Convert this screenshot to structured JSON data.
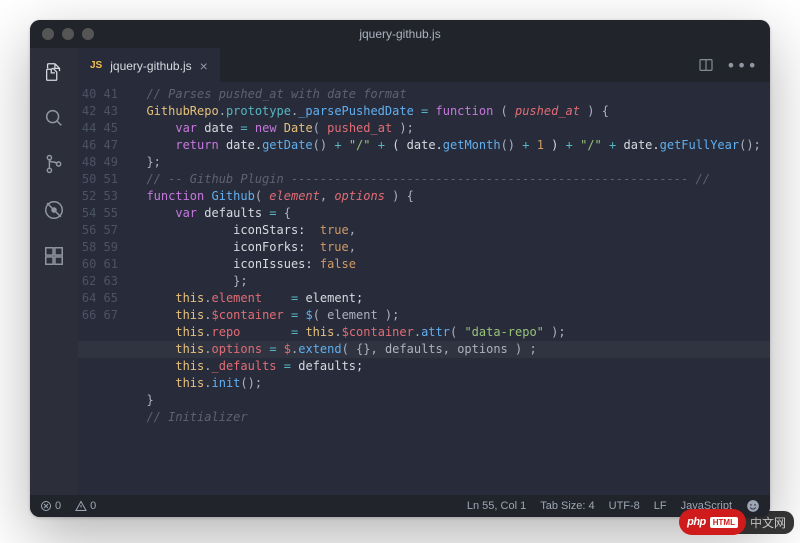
{
  "window": {
    "title": "jquery-github.js"
  },
  "activity": {
    "items": [
      "explorer",
      "search",
      "source-control",
      "debug",
      "extensions"
    ]
  },
  "tab": {
    "lang": "JS",
    "name": "jquery-github.js"
  },
  "editor": {
    "first_line": 40,
    "highlighted_line": 55,
    "lines": [
      [
        [
          "  ",
          ""
        ],
        [
          "// Parses pushed_at with date format",
          "c-comment"
        ]
      ],
      [
        [
          "  ",
          ""
        ],
        [
          "GithubRepo",
          "c-class"
        ],
        [
          ".",
          "c-punc"
        ],
        [
          "prototype",
          "c-prop"
        ],
        [
          ".",
          "c-punc"
        ],
        [
          "_parsePushedDate",
          "c-func"
        ],
        [
          " ",
          ""
        ],
        [
          "=",
          "c-op"
        ],
        [
          " ",
          ""
        ],
        [
          "function",
          "c-key"
        ],
        [
          " ( ",
          "c-punc"
        ],
        [
          "pushed_at",
          "c-param"
        ],
        [
          " ) {",
          "c-punc"
        ]
      ],
      [
        [
          "      ",
          ""
        ],
        [
          "var",
          "c-key"
        ],
        [
          " date ",
          ""
        ],
        [
          "=",
          "c-op"
        ],
        [
          " ",
          ""
        ],
        [
          "new",
          "c-key"
        ],
        [
          " ",
          ""
        ],
        [
          "Date",
          "c-class"
        ],
        [
          "( ",
          "c-punc"
        ],
        [
          "pushed_at",
          "c-var"
        ],
        [
          " );",
          "c-punc"
        ]
      ],
      [
        [
          "",
          ""
        ]
      ],
      [
        [
          "      ",
          ""
        ],
        [
          "return",
          "c-key"
        ],
        [
          " date.",
          ""
        ],
        [
          "getDate",
          "c-func"
        ],
        [
          "() ",
          "c-punc"
        ],
        [
          "+",
          "c-op"
        ],
        [
          " ",
          ""
        ],
        [
          "\"/\"",
          "c-str"
        ],
        [
          " ",
          ""
        ],
        [
          "+",
          "c-op"
        ],
        [
          " ( date.",
          ""
        ],
        [
          "getMonth",
          "c-func"
        ],
        [
          "() ",
          "c-punc"
        ],
        [
          "+",
          "c-op"
        ],
        [
          " ",
          ""
        ],
        [
          "1",
          "c-num"
        ],
        [
          " ) ",
          ""
        ],
        [
          "+",
          "c-op"
        ],
        [
          " ",
          ""
        ],
        [
          "\"/\"",
          "c-str"
        ],
        [
          " ",
          ""
        ],
        [
          "+",
          "c-op"
        ],
        [
          " date.",
          ""
        ],
        [
          "getFullYear",
          "c-func"
        ],
        [
          "();",
          "c-punc"
        ]
      ],
      [
        [
          "  };",
          "c-punc"
        ]
      ],
      [
        [
          "",
          ""
        ]
      ],
      [
        [
          "  ",
          ""
        ],
        [
          "// -- Github Plugin ------------------------------------------------------- //",
          "c-comment"
        ]
      ],
      [
        [
          "",
          ""
        ]
      ],
      [
        [
          "  ",
          ""
        ],
        [
          "function",
          "c-key"
        ],
        [
          " ",
          ""
        ],
        [
          "Github",
          "c-func"
        ],
        [
          "( ",
          "c-punc"
        ],
        [
          "element",
          "c-param"
        ],
        [
          ", ",
          "c-punc"
        ],
        [
          "options",
          "c-param"
        ],
        [
          " ) {",
          "c-punc"
        ]
      ],
      [
        [
          "      ",
          ""
        ],
        [
          "var",
          "c-key"
        ],
        [
          " defaults ",
          ""
        ],
        [
          "=",
          "c-op"
        ],
        [
          " {",
          "c-punc"
        ]
      ],
      [
        [
          "              iconStars:  ",
          ""
        ],
        [
          "true",
          "c-bool"
        ],
        [
          ",",
          "c-punc"
        ]
      ],
      [
        [
          "              iconForks:  ",
          ""
        ],
        [
          "true",
          "c-bool"
        ],
        [
          ",",
          "c-punc"
        ]
      ],
      [
        [
          "              iconIssues: ",
          ""
        ],
        [
          "false",
          "c-bool"
        ]
      ],
      [
        [
          "              };",
          "c-punc"
        ]
      ],
      [
        [
          "",
          ""
        ]
      ],
      [
        [
          "      ",
          ""
        ],
        [
          "this",
          "c-this"
        ],
        [
          ".",
          "c-punc"
        ],
        [
          "element",
          "c-var"
        ],
        [
          "    ",
          ""
        ],
        [
          "=",
          "c-op"
        ],
        [
          " element;",
          ""
        ]
      ],
      [
        [
          "      ",
          ""
        ],
        [
          "this",
          "c-this"
        ],
        [
          ".",
          "c-punc"
        ],
        [
          "$container",
          "c-var"
        ],
        [
          " ",
          ""
        ],
        [
          "=",
          "c-op"
        ],
        [
          " ",
          ""
        ],
        [
          "$",
          "c-func"
        ],
        [
          "( element );",
          "c-punc"
        ]
      ],
      [
        [
          "      ",
          ""
        ],
        [
          "this",
          "c-this"
        ],
        [
          ".",
          "c-punc"
        ],
        [
          "repo",
          "c-var"
        ],
        [
          "       ",
          ""
        ],
        [
          "=",
          "c-op"
        ],
        [
          " ",
          ""
        ],
        [
          "this",
          "c-this"
        ],
        [
          ".",
          "c-punc"
        ],
        [
          "$container",
          "c-var"
        ],
        [
          ".",
          "c-punc"
        ],
        [
          "attr",
          "c-func"
        ],
        [
          "( ",
          "c-punc"
        ],
        [
          "\"data-repo\"",
          "c-str"
        ],
        [
          " );",
          "c-punc"
        ]
      ],
      [
        [
          "",
          ""
        ]
      ],
      [
        [
          "      ",
          ""
        ],
        [
          "this",
          "c-this"
        ],
        [
          ".",
          "c-punc"
        ],
        [
          "options",
          "c-var"
        ],
        [
          " ",
          ""
        ],
        [
          "=",
          "c-op"
        ],
        [
          " ",
          ""
        ],
        [
          "$",
          "c-var"
        ],
        [
          ".",
          "c-punc"
        ],
        [
          "extend",
          "c-func"
        ],
        [
          "( {}, defaults, options ) ;",
          "c-punc"
        ]
      ],
      [
        [
          "",
          ""
        ]
      ],
      [
        [
          "      ",
          ""
        ],
        [
          "this",
          "c-this"
        ],
        [
          ".",
          "c-punc"
        ],
        [
          "_defaults",
          "c-var"
        ],
        [
          " ",
          ""
        ],
        [
          "=",
          "c-op"
        ],
        [
          " defaults;",
          ""
        ]
      ],
      [
        [
          "",
          ""
        ]
      ],
      [
        [
          "      ",
          ""
        ],
        [
          "this",
          "c-this"
        ],
        [
          ".",
          "c-punc"
        ],
        [
          "init",
          "c-func"
        ],
        [
          "();",
          "c-punc"
        ]
      ],
      [
        [
          "  }",
          "c-punc"
        ]
      ],
      [
        [
          "",
          ""
        ]
      ],
      [
        [
          "  ",
          ""
        ],
        [
          "// Initializer",
          "c-comment"
        ]
      ]
    ]
  },
  "status": {
    "errors": "0",
    "warnings": "0",
    "cursor": "Ln 55, Col 1",
    "tabsize": "Tab Size: 4",
    "encoding": "UTF-8",
    "eol": "LF",
    "language": "JavaScript"
  },
  "watermark": {
    "php": "php",
    "html": "HTML",
    "cn": "中文网"
  }
}
